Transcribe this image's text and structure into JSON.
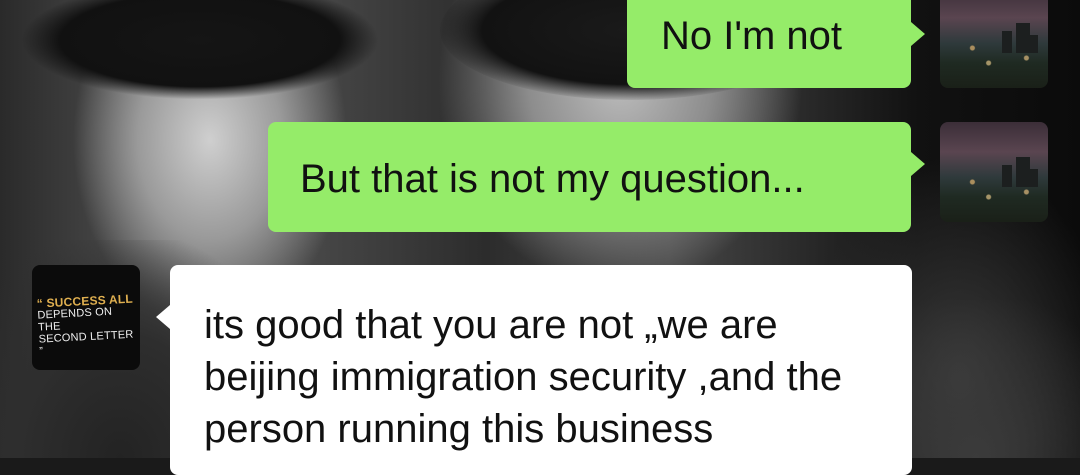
{
  "messages": [
    {
      "sender": "self",
      "text": "No I'm not"
    },
    {
      "sender": "self",
      "text": "But that is not my question..."
    },
    {
      "sender": "other",
      "text": "its good that you are not „we are beijing immigration security ,and the person running this business"
    }
  ],
  "avatars": {
    "self": {
      "icon": "city-night-photo"
    },
    "other": {
      "icon": "quote-image",
      "quote_line1": "“ SUCCESS ALL",
      "quote_line2": "DEPENDS ON THE",
      "quote_line3": "SECOND LETTER ”"
    }
  },
  "colors": {
    "sent_bubble": "#95ec69",
    "received_bubble": "#ffffff"
  }
}
